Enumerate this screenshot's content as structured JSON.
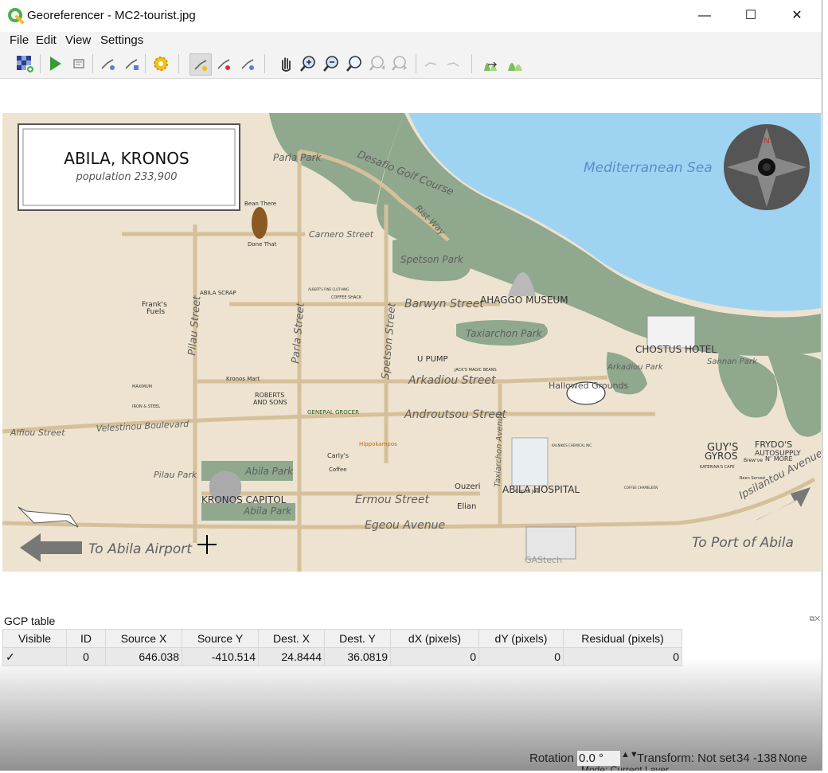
{
  "window": {
    "title": "Georeferencer - MC2-tourist.jpg",
    "minimize": "—",
    "maximize": "☐",
    "close": "✕"
  },
  "menu": [
    "File",
    "Edit",
    "View",
    "Settings"
  ],
  "map": {
    "title": "ABILA, KRONOS",
    "population": "population 233,900",
    "water": "Mediterranean Sea",
    "labels": {
      "golf": "Desafio Golf Course",
      "parla_park_top": "Parla Park",
      "rist_way": "Rist Way",
      "carnero": "Carnero Street",
      "spetson_park": "Spetson Park",
      "barwyn": "Barwyn Street",
      "ahaggo": "AHAGGO MUSEUM",
      "taxiarchon_park": "Taxiarchon Park",
      "chostus": "CHOSTUS HOTEL",
      "arkadiou_park": "Arkadiou Park",
      "sannan_park": "Sannan Park",
      "pilau_street": "Pilau Street",
      "parla_street": "Parla Street",
      "spetson_street": "Spetson Street",
      "arkadiou_street": "Arkadiou Street",
      "androutsou": "Androutsou Street",
      "alfiou": "Alfiou Street",
      "velestinou": "Velestinou Boulevard",
      "taxiarchon_avenue": "Taxiarchon Avenue",
      "abila_hospital": "ABILA HOSPITAL",
      "pilau_park": "Pilau Park",
      "abila_park_1": "Abila Park",
      "kronos_capitol": "KRONOS CAPITOL",
      "abila_park_2": "Abila Park",
      "ermou": "Ermou Street",
      "egeou": "Egeou Avenue",
      "airport": "To Abila Airport",
      "port": "To Port of Abila",
      "ipsilantou": "Ipsilantou Avenue",
      "hallowed": "Hallowed Grounds",
      "guys": "GUY'S",
      "gyros": "GYROS",
      "frydos": "FRYDO'S",
      "autosupply": "AUTOSUPPLY",
      "nmore": "N' MORE",
      "bean_there": "Bean There",
      "done_that": "Done That",
      "franks": "Frank's",
      "fuels": "Fuels",
      "abila_scrap": "ABILA SCRAP",
      "kronos_mart": "Kronos Mart",
      "maximum": "MAXIMUM",
      "iron_steel": "IRON & STEEL",
      "roberts": "ROBERTS",
      "and_sons": "AND SONS",
      "general_grocer": "GENERAL GROCER",
      "carlys": "Carly's",
      "coffee": "Coffee",
      "ouzeri": "Ouzeri",
      "elian": "Elian",
      "cup_of_joe": "Cup o' Joe",
      "gastech": "GAStech",
      "u_pump": "U PUMP",
      "jacks": "JACK'S MAGIC BEANS",
      "coffee_shack": "COFFEE SHACK",
      "albert": "ALBERT'S FINE CLOTHING",
      "brewve": "Brew've",
      "been_served": "Been Served",
      "katerinas": "KATERINA'S CAFE",
      "chameleon": "COFFEE CHAMELEON",
      "kalnikos": "KALNIKOS CHEMICAL INC.",
      "hippokampos": "Hippokampos"
    }
  },
  "gcp": {
    "title": "GCP table",
    "headers": [
      "Visible",
      "ID",
      "Source X",
      "Source Y",
      "Dest. X",
      "Dest. Y",
      "dX (pixels)",
      "dY (pixels)",
      "Residual (pixels)"
    ],
    "row": {
      "visible": "✓",
      "id": "0",
      "source_x": "646.038",
      "source_y": "-410.514",
      "dest_x": "24.8444",
      "dest_y": "36.0819",
      "dx": "0",
      "dy": "0",
      "residual": "0"
    }
  },
  "status": {
    "rotation_label": "Rotation",
    "rotation_value": "0.0 °",
    "transform": "Transform: Not set",
    "coords": "34 -138",
    "none": "None",
    "mode": "Mode: Current Layer"
  },
  "colors": {
    "water": "#9fd3f2",
    "land": "#ede3d0",
    "park": "#8fa88e",
    "road": "#d5c09a",
    "accent": "#4caf50"
  }
}
